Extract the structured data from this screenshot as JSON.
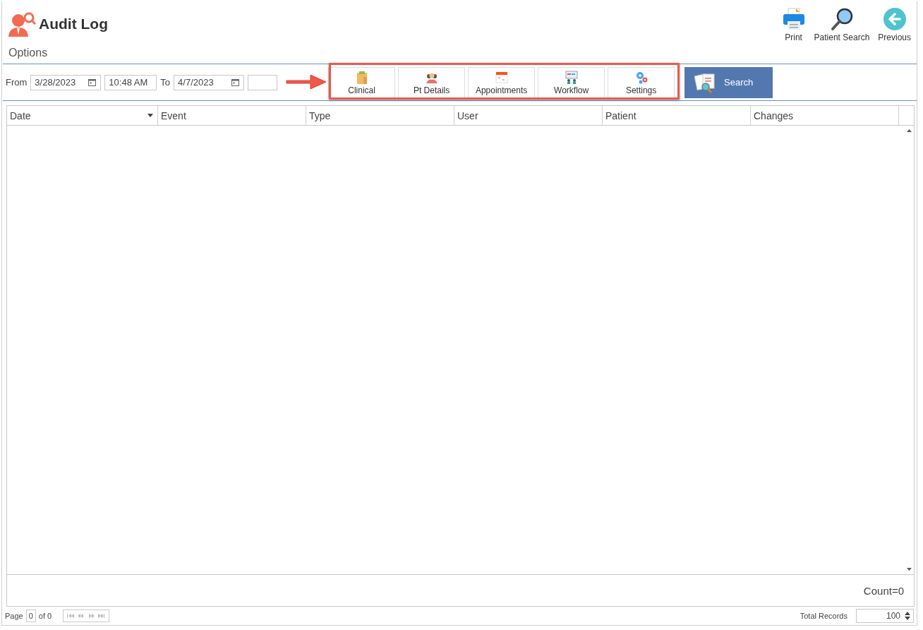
{
  "header": {
    "title": "Audit Log",
    "actions": [
      {
        "kind": "print",
        "label": "Print"
      },
      {
        "kind": "search",
        "label": "Patient Search"
      },
      {
        "kind": "back",
        "label": "Previous"
      }
    ]
  },
  "options_label": "Options",
  "filters": {
    "from_label": "From",
    "from_date": "3/28/2023",
    "from_time": "10:48 AM",
    "to_label": "To",
    "to_date": "4/7/2023"
  },
  "categories": [
    {
      "kind": "clinical",
      "label": "Clinical"
    },
    {
      "kind": "people",
      "label": "Pt Details"
    },
    {
      "kind": "calendar",
      "label": "Appointments"
    },
    {
      "kind": "workflow",
      "label": "Workflow"
    },
    {
      "kind": "gears",
      "label": "Settings"
    }
  ],
  "search_button": "Search",
  "table": {
    "columns": [
      {
        "label": "Date",
        "sort": true
      },
      {
        "label": "Event",
        "sort": false
      },
      {
        "label": "Type",
        "sort": false
      },
      {
        "label": "User",
        "sort": false
      },
      {
        "label": "Patient",
        "sort": false
      },
      {
        "label": "Changes",
        "sort": false
      }
    ],
    "count": "Count=0"
  },
  "pager": {
    "page_label": "Page",
    "page": "0",
    "of": "of 0",
    "total_label": "Total Records",
    "total": "100"
  }
}
